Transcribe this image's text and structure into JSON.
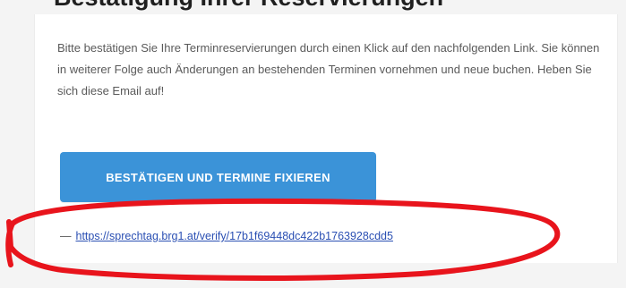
{
  "email": {
    "heading_fragment": "Bestätigung Ihrer Reservierungen",
    "body_text": "Bitte bestätigen Sie Ihre Terminreservierungen durch einen Klick auf den nachfolgenden Link. Sie können in weiterer Folge auch Änderungen an bestehenden Terminen vornehmen und neue buchen. Heben Sie sich diese Email auf!",
    "confirm_button_label": "BESTÄTIGEN UND TERMINE FIXIEREN",
    "link_prefix": "—",
    "verify_link": "https://sprechtag.brg1.at/verify/17b1f69448dc422b1763928cdd5"
  },
  "colors": {
    "button_bg": "#3b93d8",
    "link": "#2a4fb3",
    "annotation": "#e8141c"
  }
}
